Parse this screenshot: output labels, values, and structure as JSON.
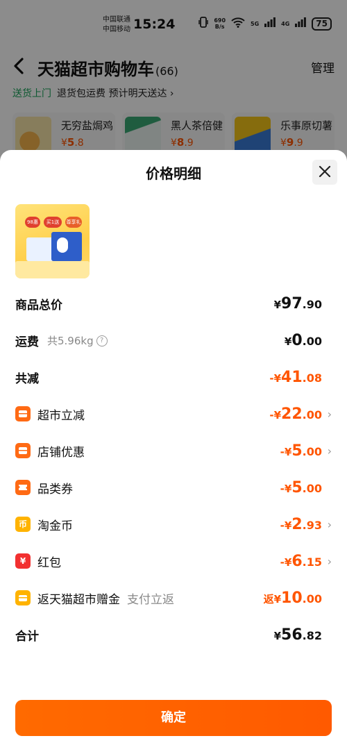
{
  "status_bar": {
    "carrier_1": "中国联通",
    "carrier_2": "中国移动",
    "time": "15:24",
    "net_speed_value": "690",
    "net_speed_unit": "B/s",
    "net_1": "5G",
    "net_2": "4G",
    "battery": "75"
  },
  "background": {
    "title": "天猫超市购物车",
    "count": "(66)",
    "manage": "管理",
    "promo_highlight": "送货上门",
    "promo_text": "退货包运费  预计明天送达",
    "products": [
      {
        "name": "无穷盐焗鸡",
        "currency": "¥",
        "price_int": "5",
        "price_dec": ".8"
      },
      {
        "name": "黑人茶倍健",
        "currency": "¥",
        "price_int": "8",
        "price_dec": ".9"
      },
      {
        "name": "乐事原切薯",
        "currency": "¥",
        "price_int": "9",
        "price_dec": ".9"
      }
    ]
  },
  "sheet": {
    "title": "价格明细",
    "product_badges": [
      "98惠",
      "买1送",
      "尊享礼"
    ],
    "rows": {
      "total": {
        "label": "商品总价",
        "currency": "¥",
        "int": "97",
        "dec": ".90"
      },
      "shipping": {
        "label": "运费",
        "sub": "共5.96kg",
        "help_icon": "?",
        "currency": "¥",
        "int": "0",
        "dec": ".00"
      },
      "discount_total": {
        "label": "共减",
        "prefix": "-¥",
        "int": "41",
        "dec": ".08"
      },
      "supermarket_off": {
        "label": "超市立减",
        "prefix": "-¥",
        "int": "22",
        "dec": ".00"
      },
      "store_discount": {
        "label": "店铺优惠",
        "prefix": "-¥",
        "int": "5",
        "dec": ".00"
      },
      "category_coupon": {
        "label": "品类券",
        "prefix": "-¥",
        "int": "5",
        "dec": ".00"
      },
      "tao_coin": {
        "label": "淘金币",
        "icon_text": "币",
        "prefix": "-¥",
        "int": "2",
        "dec": ".93"
      },
      "red_packet": {
        "label": "红包",
        "icon_text": "¥",
        "prefix": "-¥",
        "int": "6",
        "dec": ".15"
      },
      "cashback": {
        "label": "返天猫超市赠金",
        "note": "支付立返",
        "prefix": "返¥",
        "int": "10",
        "dec": ".00"
      },
      "sum": {
        "label": "合计",
        "currency": "¥",
        "int": "56",
        "dec": ".82"
      }
    },
    "confirm_label": "确定"
  },
  "colors": {
    "accent_orange": "#ff5500",
    "button_orange": "#ff6a00",
    "promo_green": "#1aa35a",
    "coin_yellow": "#ffb300",
    "packet_red": "#f23030"
  }
}
